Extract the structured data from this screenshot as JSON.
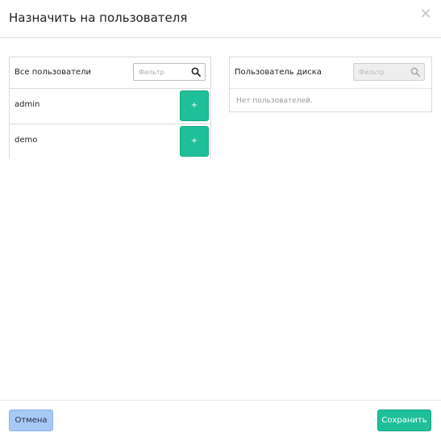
{
  "dialog": {
    "title": "Назначить на пользователя",
    "close_icon": "close-icon"
  },
  "all_users": {
    "title": "Все пользователи",
    "filter_placeholder": "Фильтр",
    "filter_value": "",
    "items": [
      {
        "name": "admin",
        "action_label": "+"
      },
      {
        "name": "demo",
        "action_label": "+"
      }
    ]
  },
  "disk_users": {
    "title": "Пользователь диска",
    "filter_placeholder": "Фильтр",
    "filter_value": "",
    "empty_text": "Нет пользователей."
  },
  "footer": {
    "cancel_label": "Отмена",
    "save_label": "Сохранить"
  },
  "colors": {
    "accent": "#1fbf99",
    "cancel_bg": "#a8c8f5"
  }
}
